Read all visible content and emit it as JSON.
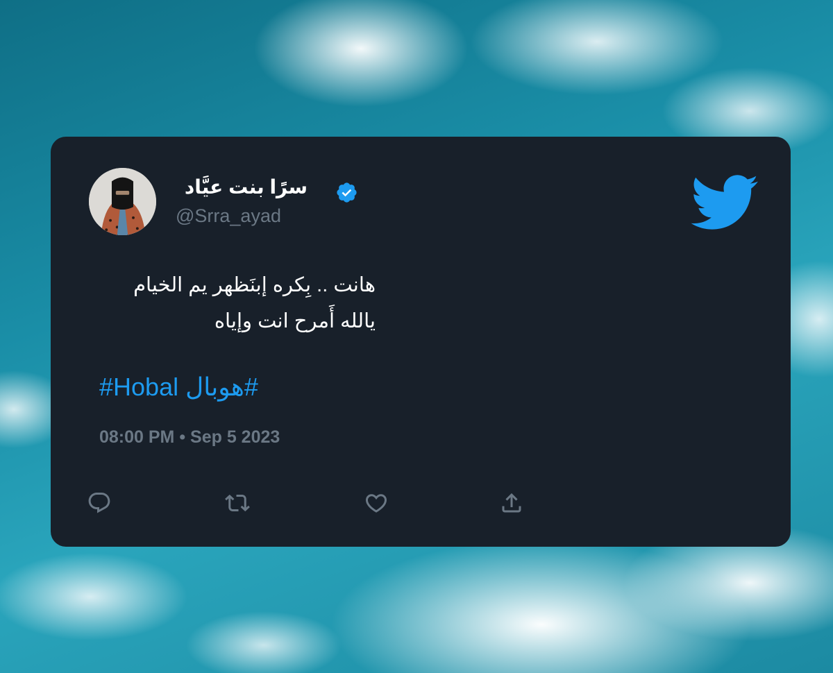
{
  "tweet": {
    "author_name": "سرًا بنت عيَّاد",
    "handle": "@Srra_ayad",
    "text_line1": "هانت .. بِكره إبنَظهر يم الخيام",
    "text_line2": "يالله أَمرح انت وإياه",
    "hashtag": "#Hobal هوبال#",
    "timestamp": "08:00 PM • Sep 5 2023"
  },
  "icons": {
    "avatar": "profile-photo",
    "verified": "verified-badge-icon",
    "brand": "twitter-bird-icon",
    "actions": [
      "reply-icon",
      "retweet-icon",
      "like-icon",
      "share-icon"
    ]
  },
  "colors": {
    "card_background": "#18202a",
    "accent": "#1d9bf0",
    "muted_text": "#6b7885",
    "primary_text": "#ffffff"
  }
}
